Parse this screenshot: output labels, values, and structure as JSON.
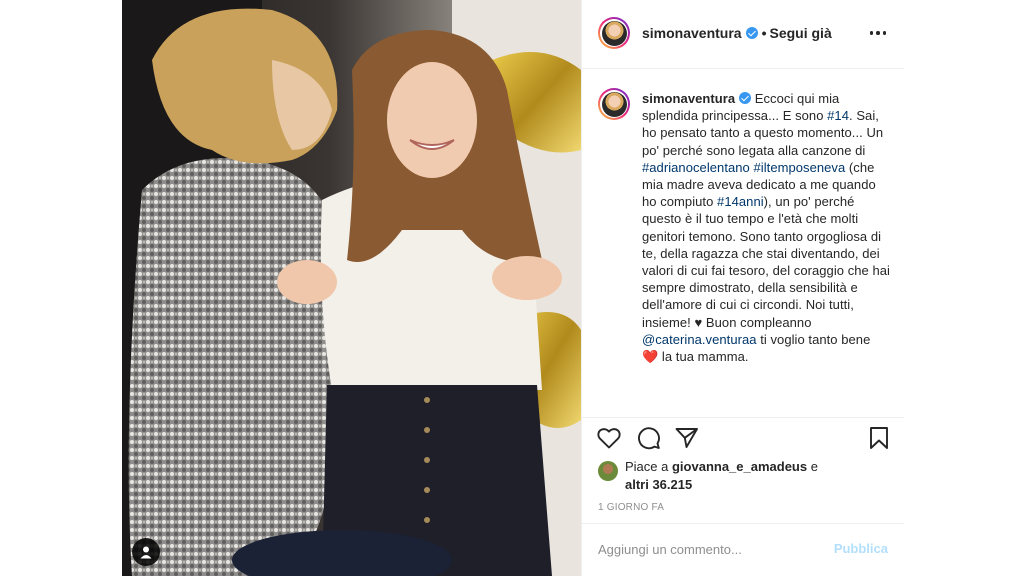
{
  "post": {
    "username": "simonaventura",
    "separator": "•",
    "follow_label": "Segui già"
  },
  "caption": {
    "username": "simonaventura",
    "seg1": " Eccoci qui mia splendida principessa... E sono ",
    "tag1": "#14",
    "seg2": ". Sai, ho pensato tanto a questo momento... Un po' perché sono legata alla canzone di ",
    "tag2": "#adrianocelentano",
    "seg3": " ",
    "tag3": "#iltemposeneva",
    "seg4": " (che mia madre aveva dedicato a me quando ho compiuto ",
    "tag4": "#14anni",
    "seg5": "), un po' perché questo è il tuo tempo e l'età che molti genitori temono. Sono tanto orgogliosa di te, della ragazza che stai diventando, dei valori di cui fai tesoro, del coraggio che hai sempre dimostrato, della sensibilità e dell'amore di cui ci circondi. Noi tutti, insieme! ",
    "heart_small": "♥",
    "seg6": " Buon compleanno ",
    "mention": "@caterina.venturaa",
    "seg7": " ti voglio tanto bene ",
    "heart_big": "❤️",
    "seg8": " la tua mamma."
  },
  "likes": {
    "prefix": "Piace a ",
    "user": "giovanna_e_amadeus",
    "connector": " e",
    "others": "altri 36.215"
  },
  "timestamp": "1 GIORNO FA",
  "comment": {
    "placeholder": "Aggiungi un commento...",
    "publish_label": "Pubblica"
  },
  "icons": {
    "like": "heart-outline-icon",
    "comment": "comment-bubble-icon",
    "share": "paper-plane-icon",
    "save": "bookmark-icon",
    "more": "more-options-icon",
    "tag_user": "user-tag-icon"
  },
  "colors": {
    "link": "#00376b",
    "verified": "#3897f0",
    "publish_disabled": "#b2dffc",
    "muted": "#8e8e8e",
    "border": "#efefef"
  }
}
